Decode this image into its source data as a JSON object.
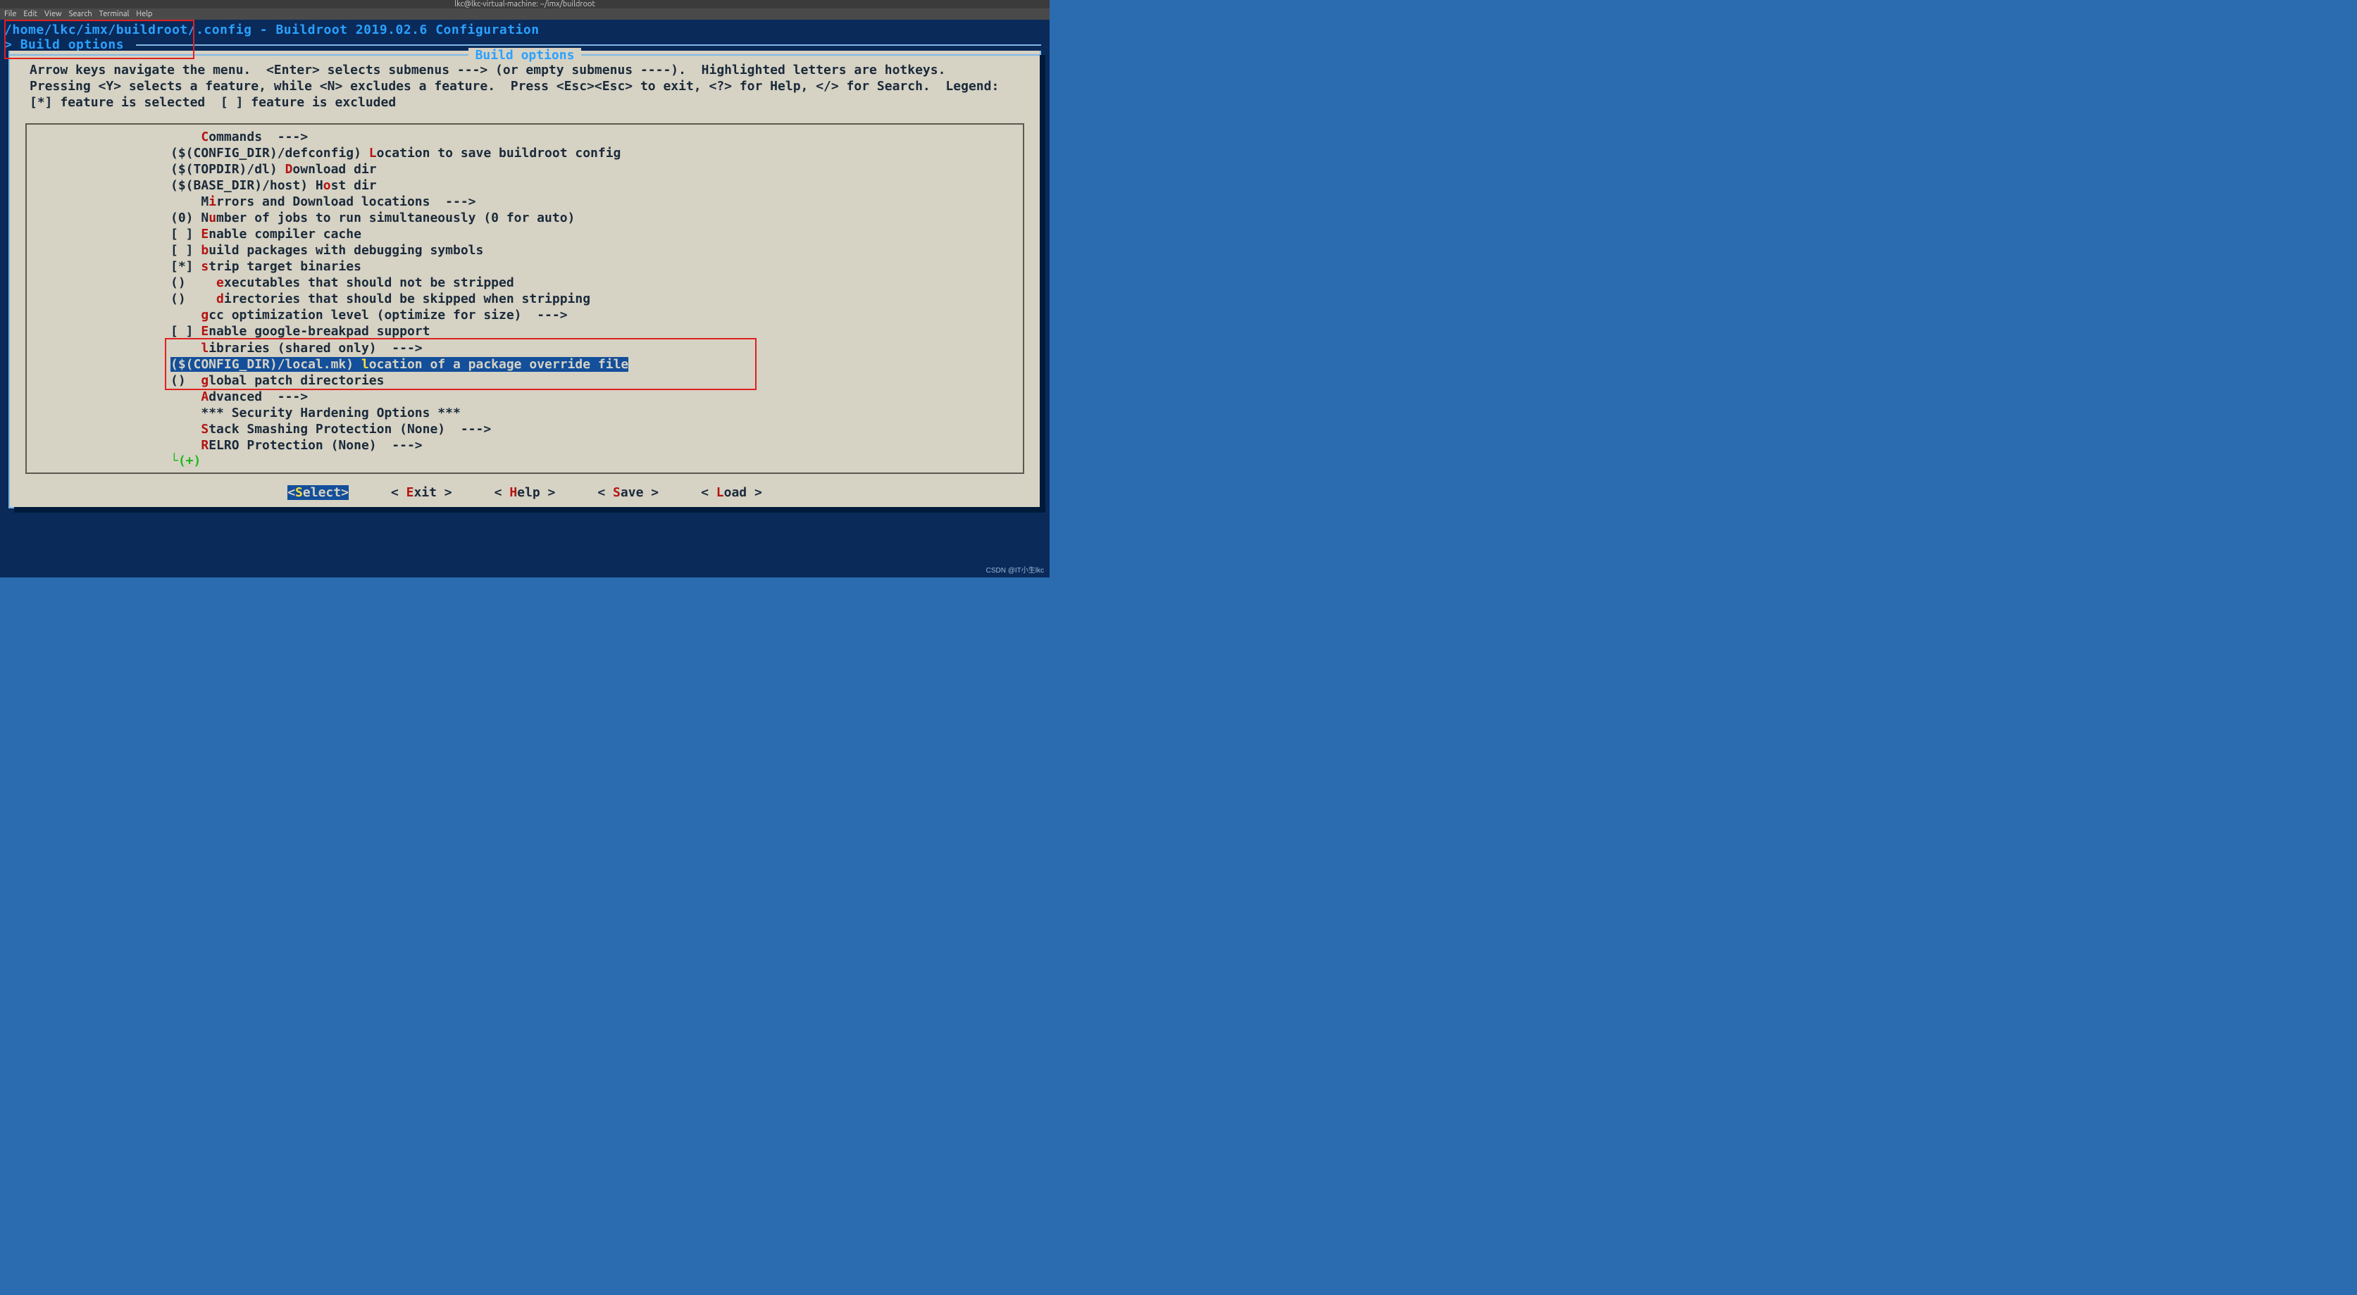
{
  "window": {
    "title": "lkc@lkc-virtual-machine: ~/imx/buildroot"
  },
  "menubar": {
    "items": [
      "File",
      "Edit",
      "View",
      "Search",
      "Terminal",
      "Help"
    ]
  },
  "header": {
    "path_line": "/home/lkc/imx/buildroot/.config - Buildroot 2019.02.6 Configuration",
    "breadcrumb_prefix": "> ",
    "breadcrumb": "Build options",
    "box_title": "Build options"
  },
  "help": {
    "text": "Arrow keys navigate the menu.  <Enter> selects submenus ---> (or empty submenus ----).  Highlighted letters are hotkeys.  Pressing <Y> selects a feature, while <N> excludes a feature.  Press <Esc><Esc> to exit, <?> for Help, </> for Search.  Legend: [*] feature is selected  [ ] feature is excluded"
  },
  "menu": {
    "items": [
      {
        "prefix": "    ",
        "hot": "C",
        "rest": "ommands  --->"
      },
      {
        "prefix": "($(CONFIG_DIR)/defconfig) ",
        "hot": "L",
        "rest": "ocation to save buildroot config"
      },
      {
        "prefix": "($(TOPDIR)/dl) ",
        "hot": "D",
        "rest": "ownload dir"
      },
      {
        "prefix": "($(BASE_DIR)/host) H",
        "hot": "o",
        "rest": "st dir"
      },
      {
        "prefix": "    M",
        "hot": "i",
        "rest": "rrors and Download locations  --->"
      },
      {
        "prefix": "(0) N",
        "hot": "u",
        "rest": "mber of jobs to run simultaneously (0 for auto)"
      },
      {
        "prefix": "[ ] ",
        "hot": "E",
        "rest": "nable compiler cache"
      },
      {
        "prefix": "[ ] ",
        "hot": "b",
        "rest": "uild packages with debugging symbols"
      },
      {
        "prefix": "[*] ",
        "hot": "s",
        "rest": "trip target binaries"
      },
      {
        "prefix": "()    ",
        "hot": "e",
        "rest": "xecutables that should not be stripped"
      },
      {
        "prefix": "()    ",
        "hot": "d",
        "rest": "irectories that should be skipped when stripping"
      },
      {
        "prefix": "    ",
        "hot": "g",
        "rest": "cc optimization level (optimize for size)  --->"
      },
      {
        "prefix": "[ ] ",
        "hot": "E",
        "rest": "nable google-breakpad support"
      },
      {
        "prefix": "    ",
        "hot": "l",
        "rest": "ibraries (shared only)  --->"
      },
      {
        "prefix": "($(CONFIG_DIR)/local.mk) ",
        "hot": "l",
        "rest": "ocation of a package override file",
        "selected": true
      },
      {
        "prefix": "()  ",
        "hot": "g",
        "rest": "lobal patch directories"
      },
      {
        "prefix": "    ",
        "hot": "A",
        "rest": "dvanced  --->"
      },
      {
        "prefix": "    ",
        "hot": "",
        "rest": "*** Security Hardening Options ***"
      },
      {
        "prefix": "    ",
        "hot": "S",
        "rest": "tack Smashing Protection (None)  --->"
      },
      {
        "prefix": "    ",
        "hot": "R",
        "rest": "ELRO Protection (None)  --->"
      }
    ],
    "more": "└(+)"
  },
  "buttons": {
    "items": [
      {
        "pre": "<",
        "hot": "S",
        "post": "elect>",
        "selected": true
      },
      {
        "pre": "< ",
        "hot": "E",
        "post": "xit >"
      },
      {
        "pre": "< ",
        "hot": "H",
        "post": "elp >"
      },
      {
        "pre": "< ",
        "hot": "S",
        "post": "ave >"
      },
      {
        "pre": "< ",
        "hot": "L",
        "post": "oad >"
      }
    ]
  },
  "watermark": "CSDN @IT小生lkc"
}
